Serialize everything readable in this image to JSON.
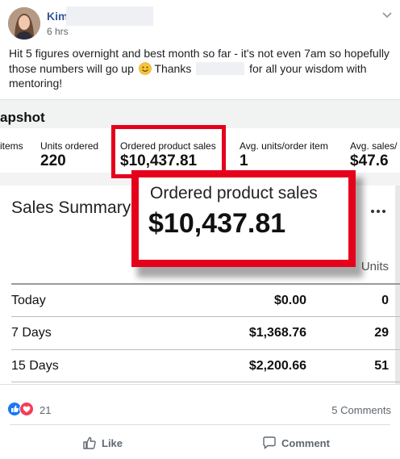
{
  "post": {
    "author": "Kim",
    "time": "6 hrs",
    "text_part1": "Hit 5 figures overnight and best month so far - it's not even 7am so hopefully those numbers will go up",
    "text_part2": " Thanks",
    "text_part3": "for all your wisdom with mentoring!"
  },
  "screenshot": {
    "snapshot_title": "apshot",
    "metrics": [
      {
        "label": "items",
        "value": ""
      },
      {
        "label": "Units ordered",
        "value": "220"
      },
      {
        "label": "Ordered product sales",
        "value": "$10,437.81"
      },
      {
        "label": "Avg. units/order item",
        "value": "1"
      },
      {
        "label": "Avg. sales/",
        "value": "$47.6"
      }
    ],
    "zoom": {
      "label": "Ordered product sales",
      "value": "$10,437.81"
    },
    "summary": {
      "title": "Sales Summary",
      "units_header": "Units",
      "rows": [
        {
          "period": "Today",
          "sales": "$0.00",
          "units": "0"
        },
        {
          "period": "7 Days",
          "sales": "$1,368.76",
          "units": "29"
        },
        {
          "period": "15 Days",
          "sales": "$2,200.66",
          "units": "51"
        }
      ]
    }
  },
  "footer": {
    "reaction_count": "21",
    "comments": "5 Comments",
    "like_label": "Like",
    "comment_label": "Comment"
  },
  "colors": {
    "highlight": "#e5001c",
    "author": "#385898",
    "like": "#1877f2",
    "love": "#f33e58"
  }
}
